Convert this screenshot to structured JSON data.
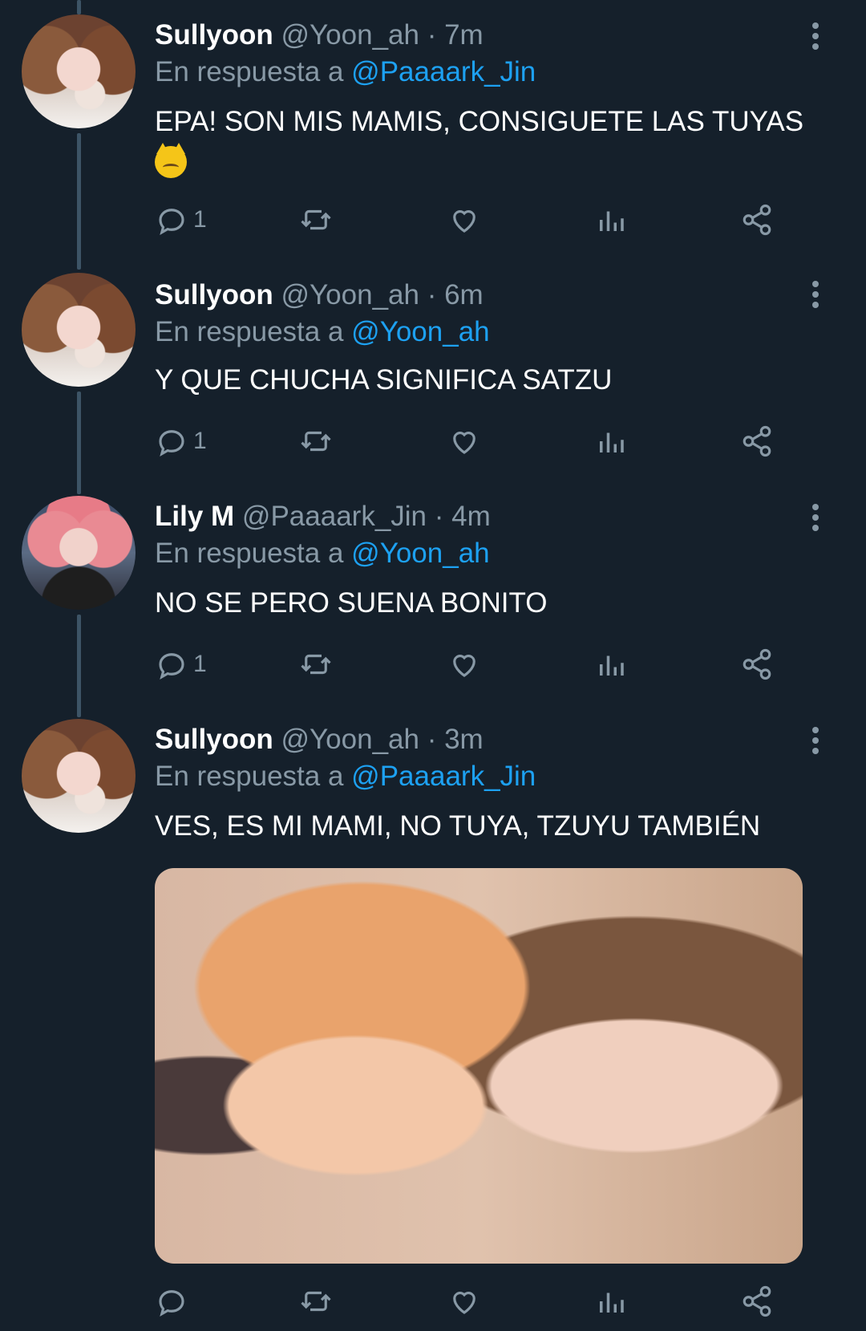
{
  "tweets": [
    {
      "name": "Sullyoon",
      "handle": "@Yoon_ah · 7m",
      "reply_prefix": "En respuesta a",
      "reply_to": "@Paaaark_Jin",
      "text": "EPA! SON MIS MAMIS, CONSIGUETE LAS TUYAS",
      "emoji": "pouting-cat-emoji",
      "reply_count": "1",
      "avatar": "sullyoon-avatar"
    },
    {
      "name": "Sullyoon",
      "handle": "@Yoon_ah · 6m",
      "reply_prefix": "En respuesta a",
      "reply_to": "@Yoon_ah",
      "text": "Y QUE CHUCHA SIGNIFICA SATZU",
      "reply_count": "1",
      "avatar": "sullyoon-avatar"
    },
    {
      "name": "Lily M",
      "handle": "@Paaaark_Jin · 4m",
      "reply_prefix": "En respuesta a",
      "reply_to": "@Yoon_ah",
      "text": "NO SE PERO SUENA BONITO",
      "reply_count": "1",
      "avatar": "lily-avatar"
    },
    {
      "name": "Sullyoon",
      "handle": "@Yoon_ah · 3m",
      "reply_prefix": "En respuesta a",
      "reply_to": "@Paaaark_Jin",
      "text": "VES, ES MI MAMI, NO TUYA, TZUYU TAMBIÉN",
      "reply_count": "",
      "avatar": "sullyoon-avatar"
    }
  ],
  "icons": [
    "reply-icon",
    "retweet-icon",
    "like-icon",
    "analytics-icon",
    "share-icon",
    "more-options-icon"
  ],
  "colors": {
    "background": "#15202b",
    "accent": "#1da1f2",
    "muted": "#8899a6",
    "thread_line": "#3d5466"
  }
}
